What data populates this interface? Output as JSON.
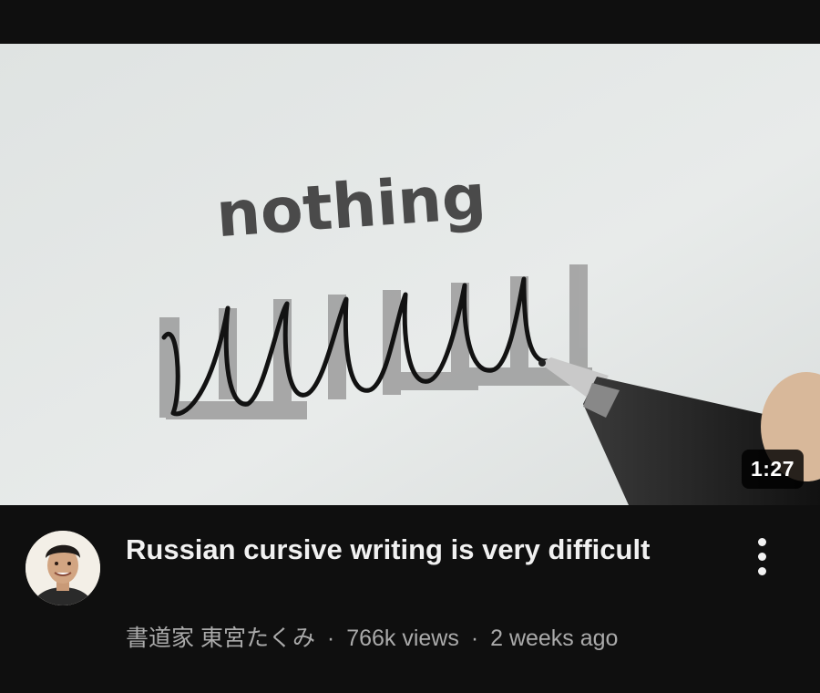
{
  "video": {
    "thumbnail": {
      "word": "nothing",
      "duration": "1:27"
    },
    "title": "Russian cursive writing is very difficult",
    "channel": "書道家 東宮たくみ",
    "views": "766k views",
    "age": "2 weeks ago",
    "separator": "·",
    "menu_icon": "more-vert-icon"
  }
}
